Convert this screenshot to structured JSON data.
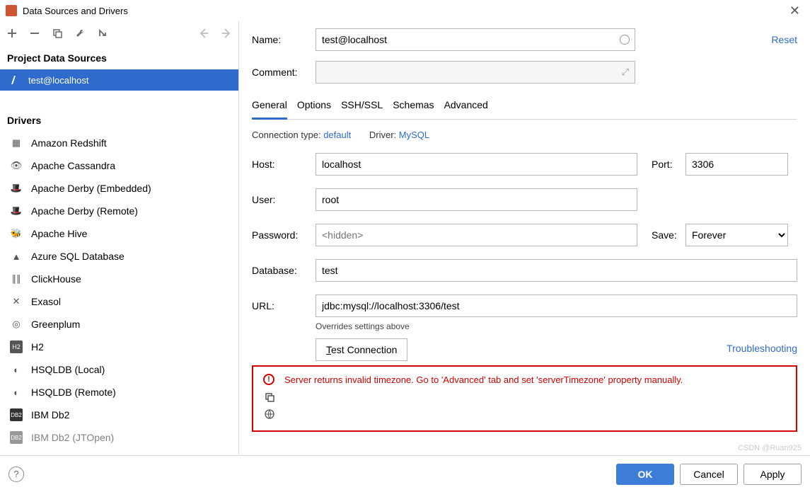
{
  "titlebar": {
    "title": "Data Sources and Drivers"
  },
  "sidebar": {
    "project_header": "Project Data Sources",
    "data_sources": [
      {
        "label": "test@localhost"
      }
    ],
    "drivers_header": "Drivers",
    "drivers": [
      {
        "label": "Amazon Redshift"
      },
      {
        "label": "Apache Cassandra"
      },
      {
        "label": "Apache Derby (Embedded)"
      },
      {
        "label": "Apache Derby (Remote)"
      },
      {
        "label": "Apache Hive"
      },
      {
        "label": "Azure SQL Database"
      },
      {
        "label": "ClickHouse"
      },
      {
        "label": "Exasol"
      },
      {
        "label": "Greenplum"
      },
      {
        "label": "H2"
      },
      {
        "label": "HSQLDB (Local)"
      },
      {
        "label": "HSQLDB (Remote)"
      },
      {
        "label": "IBM Db2"
      },
      {
        "label": "IBM Db2 (JTOpen)"
      }
    ]
  },
  "main": {
    "name_label": "Name:",
    "name_value": "test@localhost",
    "comment_label": "Comment:",
    "reset": "Reset",
    "tabs": [
      "General",
      "Options",
      "SSH/SSL",
      "Schemas",
      "Advanced"
    ],
    "active_tab": 0,
    "conn_type_label": "Connection type:",
    "conn_type_value": "default",
    "driver_label": "Driver:",
    "driver_value": "MySQL",
    "host_label": "Host:",
    "host_value": "localhost",
    "port_label": "Port:",
    "port_value": "3306",
    "user_label": "User:",
    "user_value": "root",
    "password_label": "Password:",
    "password_placeholder": "<hidden>",
    "save_label": "Save:",
    "save_value": "Forever",
    "database_label": "Database:",
    "database_value": "test",
    "url_label": "URL:",
    "url_value": "jdbc:mysql://localhost:3306/test",
    "url_hint": "Overrides settings above",
    "test_connection": "Test Connection",
    "troubleshooting": "Troubleshooting",
    "error_text": "Server returns invalid timezone. Go to 'Advanced' tab and set 'serverTimezone' property manually."
  },
  "footer": {
    "ok": "OK",
    "cancel": "Cancel",
    "apply": "Apply"
  },
  "watermark": "CSDN @Ruan925"
}
